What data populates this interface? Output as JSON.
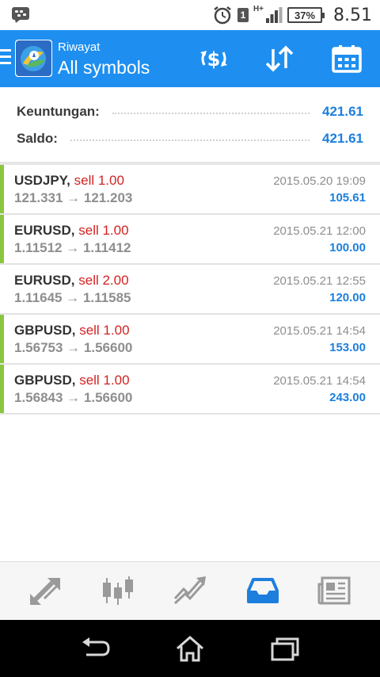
{
  "status_bar": {
    "time": "8.51",
    "battery": "37%",
    "sim_label": "1",
    "network": "H+"
  },
  "app_bar": {
    "subtitle": "Riwayat",
    "title": "All symbols"
  },
  "summary": {
    "profit_label": "Keuntungan:",
    "profit_value": "421.61",
    "balance_label": "Saldo:",
    "balance_value": "421.61"
  },
  "trades": [
    {
      "symbol": "USDJPY,",
      "side": "sell 1.00",
      "prices": "121.331 → 121.203",
      "datetime": "2015.05.20 19:09",
      "profit": "105.61",
      "bar": true
    },
    {
      "symbol": "EURUSD,",
      "side": "sell 1.00",
      "prices": "1.11512 → 1.11412",
      "datetime": "2015.05.21 12:00",
      "profit": "100.00",
      "bar": true
    },
    {
      "symbol": "EURUSD,",
      "side": "sell 2.00",
      "prices": "1.11645 → 1.11585",
      "datetime": "2015.05.21 12:55",
      "profit": "120.00",
      "bar": false
    },
    {
      "symbol": "GBPUSD,",
      "side": "sell 1.00",
      "prices": "1.56753 → 1.56600",
      "datetime": "2015.05.21 14:54",
      "profit": "153.00",
      "bar": true
    },
    {
      "symbol": "GBPUSD,",
      "side": "sell 1.00",
      "prices": "1.56843 → 1.56600",
      "datetime": "2015.05.21 14:54",
      "profit": "243.00",
      "bar": true
    }
  ],
  "tabs": [
    {
      "icon": "quotes-arrows-icon",
      "active": false
    },
    {
      "icon": "candlestick-chart-icon",
      "active": false
    },
    {
      "icon": "trade-trend-icon",
      "active": false
    },
    {
      "icon": "history-inbox-icon",
      "active": true
    },
    {
      "icon": "news-icon",
      "active": false
    }
  ],
  "colors": {
    "accent": "#1e8ff0",
    "profit_blue": "#1c7fdd",
    "sell_red": "#d32222",
    "bar_green": "#8ac640",
    "icon_gray": "#9a9a9a"
  }
}
